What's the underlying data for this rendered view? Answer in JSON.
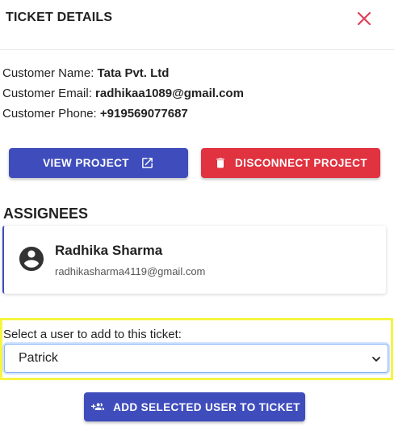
{
  "header": {
    "title": "TICKET DETAILS",
    "close_icon": "close-icon",
    "close_color": "#e0405a"
  },
  "customer": {
    "name_label": "Customer Name: ",
    "name": "Tata Pvt. Ltd",
    "email_label": "Customer Email: ",
    "email": "radhikaa1089@gmail.com",
    "phone_label": "Customer Phone: ",
    "phone": "+919569077687"
  },
  "actions": {
    "view_label": "VIEW PROJECT",
    "view_icon": "external-link-icon",
    "disconnect_label": "DISCONNECT PROJECT",
    "disconnect_icon": "trash-icon"
  },
  "assignees": {
    "title": "ASSIGNEES",
    "items": [
      {
        "name": "Radhika Sharma",
        "email": "radhikasharma4119@gmail.com",
        "icon": "account-circle-icon"
      }
    ]
  },
  "add_user": {
    "label": "Select a user to add to this ticket:",
    "selected": "Patrick",
    "button_label": "ADD SELECTED USER TO TICKET",
    "button_icon": "group-add-icon"
  },
  "colors": {
    "primary": "#3f4dbc",
    "danger": "#e0323f",
    "highlight": "#f5f542"
  }
}
